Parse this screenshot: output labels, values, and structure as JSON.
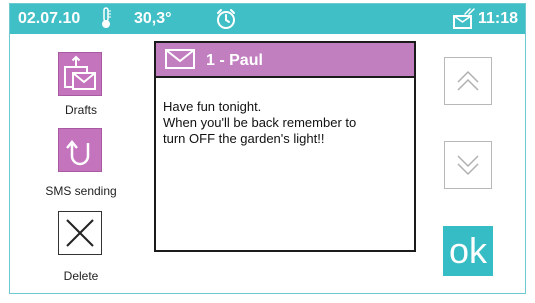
{
  "status": {
    "date": "02.07.10",
    "temperature": "30,3°",
    "time": "11:18",
    "icons": [
      "thermometer-icon",
      "alarm-clock-icon",
      "message-status-icon"
    ]
  },
  "sidebar": {
    "drafts_label": "Drafts",
    "sms_sending_label": "SMS sending",
    "delete_label": "Delete"
  },
  "message": {
    "sender": "1 - Paul",
    "lines": [
      "Have fun tonight.",
      "When you'll be back remember to",
      "turn OFF the garden's light!!"
    ]
  },
  "buttons": {
    "ok_label": "ok",
    "scroll_up": "chevron-up-icon",
    "scroll_down": "chevron-down-icon"
  },
  "colors": {
    "status_bar": "#40bfc6",
    "accent_pink": "#c474bc",
    "ok_button": "#35bcc4"
  }
}
